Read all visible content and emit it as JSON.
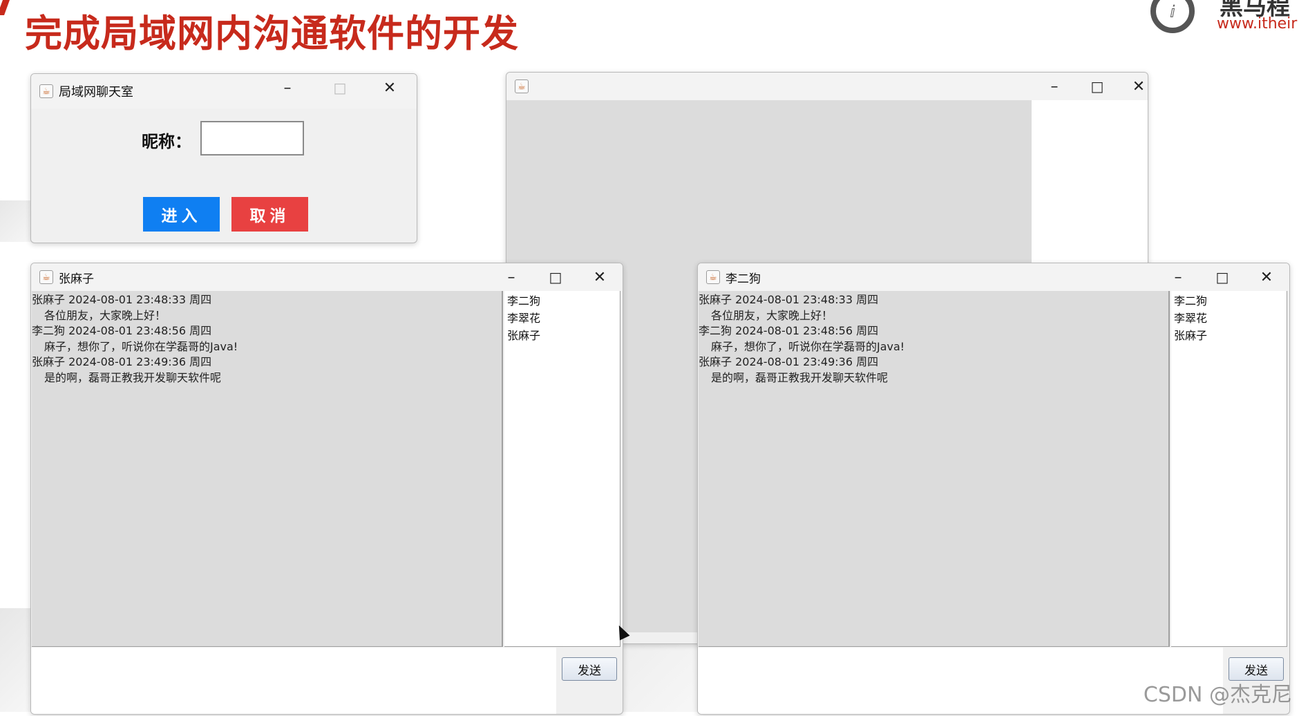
{
  "slide": {
    "title": "完成局域网内沟通软件的开发",
    "logo_text": "黑马程",
    "logo_url": "www.itheir"
  },
  "login_window": {
    "title": "局域网聊天室",
    "nickname_label": "昵称：",
    "nickname_value": "",
    "enter_label": "进入",
    "cancel_label": "取消"
  },
  "controls": {
    "minimize": "–",
    "maximize": "□",
    "close": "✕"
  },
  "chat_window_1": {
    "title": "张麻子",
    "messages": [
      {
        "header": "张麻子  2024-08-01 23:48:33 周四",
        "body": "各位朋友，大家晚上好！"
      },
      {
        "header": "李二狗  2024-08-01 23:48:56 周四",
        "body": "麻子，想你了，听说你在学磊哥的Java!"
      },
      {
        "header": "张麻子  2024-08-01 23:49:36 周四",
        "body": "是的啊，磊哥正教我开发聊天软件呢"
      }
    ],
    "users": [
      "李二狗",
      "李翠花",
      "张麻子"
    ],
    "send_label": "发送"
  },
  "chat_window_2": {
    "title": "李二狗",
    "messages": [
      {
        "header": "张麻子  2024-08-01 23:48:33 周四",
        "body": "各位朋友，大家晚上好！"
      },
      {
        "header": "李二狗  2024-08-01 23:48:56 周四",
        "body": "麻子，想你了，听说你在学磊哥的Java!"
      },
      {
        "header": "张麻子  2024-08-01 23:49:36 周四",
        "body": "是的啊，磊哥正教我开发聊天软件呢"
      }
    ],
    "users": [
      "李二狗",
      "李翠花",
      "张麻子"
    ],
    "send_label": "发送"
  },
  "watermark": "CSDN @杰克尼"
}
